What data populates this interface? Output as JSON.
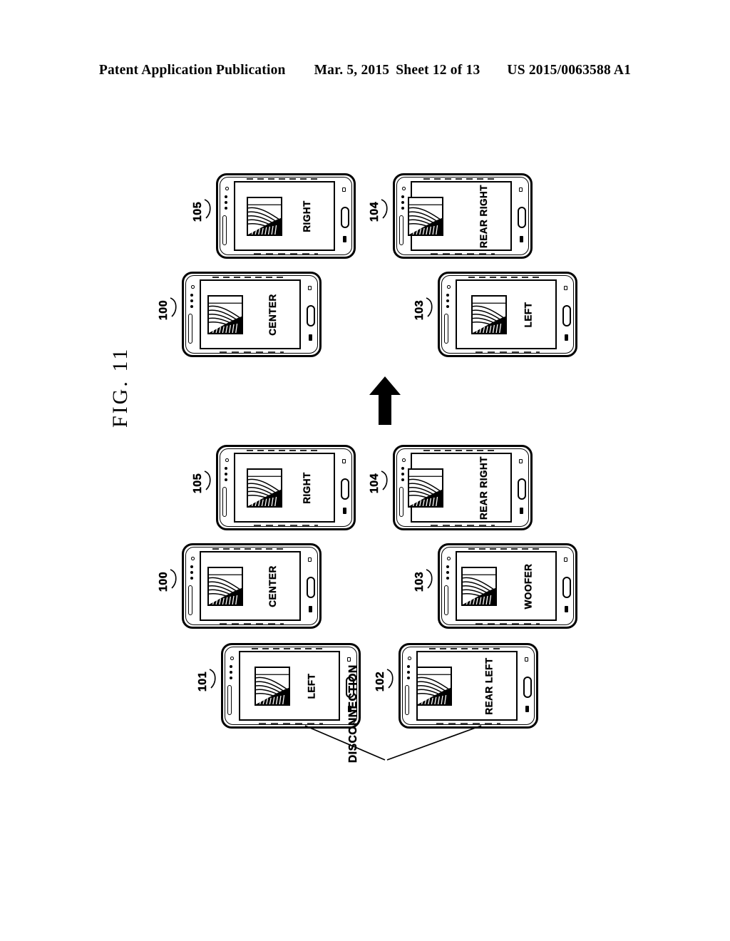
{
  "header": {
    "publication": "Patent Application Publication",
    "date": "Mar. 5, 2015",
    "sheet": "Sheet 12 of 13",
    "patent_number": "US 2015/0063588 A1"
  },
  "figure": {
    "label": "FIG. 11",
    "flow_arrow": "up-arrow",
    "annotation": "DISCONNECTION"
  },
  "groups": {
    "before": {
      "name": "initial-configuration",
      "devices": [
        {
          "ref": "105",
          "caption": "RIGHT",
          "icon": "speaker-icon"
        },
        {
          "ref": "104",
          "caption": "REAR RIGHT",
          "icon": "speaker-icon"
        },
        {
          "ref": "100",
          "caption": "CENTER",
          "icon": "speaker-icon"
        },
        {
          "ref": "103",
          "caption": "WOOFER",
          "icon": "speaker-icon"
        },
        {
          "ref": "101",
          "caption": "LEFT",
          "icon": "speaker-icon"
        },
        {
          "ref": "102",
          "caption": "REAR LEFT",
          "icon": "speaker-icon"
        }
      ]
    },
    "after": {
      "name": "reconfigured-after-disconnection",
      "devices": [
        {
          "ref": "105",
          "caption": "RIGHT",
          "icon": "speaker-icon"
        },
        {
          "ref": "104",
          "caption": "REAR RIGHT",
          "icon": "speaker-icon"
        },
        {
          "ref": "100",
          "caption": "CENTER",
          "icon": "speaker-icon"
        },
        {
          "ref": "103",
          "caption": "LEFT",
          "icon": "speaker-icon"
        }
      ]
    }
  },
  "colors": {
    "ink": "#000000",
    "paper": "#ffffff"
  }
}
